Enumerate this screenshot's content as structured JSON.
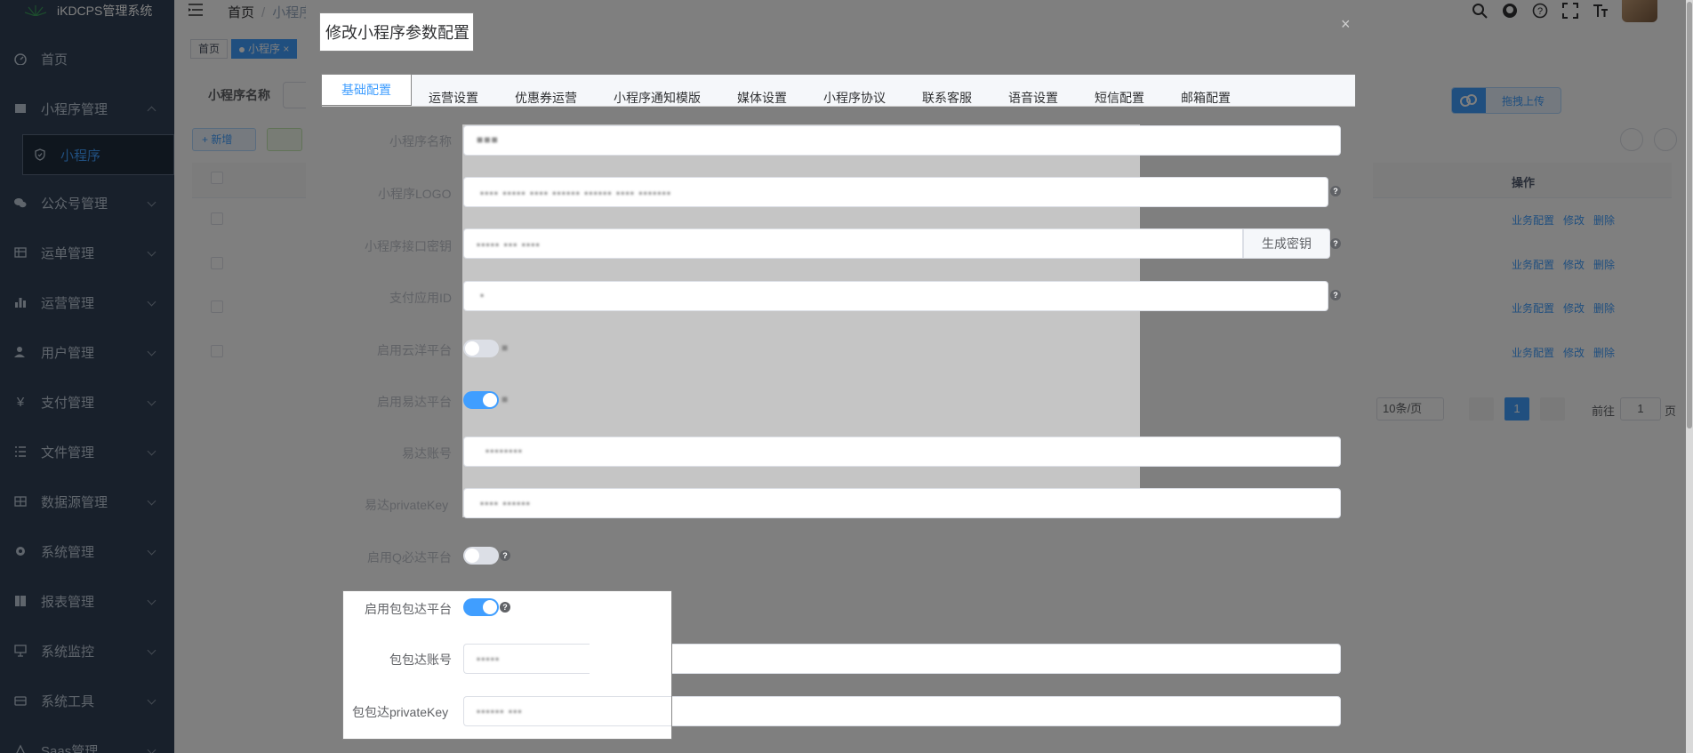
{
  "app": {
    "title": "iKDCPS管理系统"
  },
  "sidebar": {
    "items": [
      {
        "label": "首页",
        "icon": "dashboard-icon"
      },
      {
        "label": "小程序管理",
        "icon": "miniapp-icon"
      },
      {
        "label": "公众号管理",
        "icon": "wechat-icon"
      },
      {
        "label": "运单管理",
        "icon": "waybill-icon"
      },
      {
        "label": "运营管理",
        "icon": "chart-icon"
      },
      {
        "label": "用户管理",
        "icon": "user-icon"
      },
      {
        "label": "支付管理",
        "icon": "yen-icon"
      },
      {
        "label": "文件管理",
        "icon": "list-icon"
      },
      {
        "label": "数据源管理",
        "icon": "grid-icon"
      },
      {
        "label": "系统管理",
        "icon": "gear-icon"
      },
      {
        "label": "报表管理",
        "icon": "report-icon"
      },
      {
        "label": "系统监控",
        "icon": "monitor-icon"
      },
      {
        "label": "系统工具",
        "icon": "tool-icon"
      },
      {
        "label": "Saas管理",
        "icon": "saas-icon"
      }
    ],
    "active_sub": "小程序"
  },
  "navbar": {
    "breadcrumb_home": "首页",
    "breadcrumb_current": "小程序"
  },
  "tags": {
    "home": "首页",
    "active": "小程序"
  },
  "background": {
    "search_label": "小程序名称",
    "add_button": "新增",
    "ops_header": "操作",
    "row_ops": [
      "业务配置",
      "修改",
      "删除"
    ],
    "upload_text": "拖拽上传",
    "page_size": "10条/页",
    "page_current": "1",
    "goto_label": "前往",
    "goto_value": "1",
    "page_unit": "页"
  },
  "dialog": {
    "title": "修改小程序参数配置",
    "tabs": [
      "基础配置",
      "运营设置",
      "优惠券运营",
      "小程序通知模版",
      "媒体设置",
      "小程序协议",
      "联系客服",
      "语音设置",
      "短信配置",
      "邮箱配置"
    ],
    "fields": {
      "name_label": "小程序名称",
      "logo_label": "小程序LOGO",
      "secret_label": "小程序接口密钥",
      "gen_button": "生成密钥",
      "payid_label": "支付应用ID",
      "yunyang_label": "启用云洋平台",
      "yida_label": "启用易达平台",
      "yida_account_label": "易达账号",
      "yida_key_label": "易达privateKey",
      "qbida_label": "启用Q必达平台",
      "baobaoda_label": "启用包包达平台",
      "baobaoda_account_label": "包包达账号",
      "baobaoda_key_label": "包包达privateKey"
    }
  }
}
